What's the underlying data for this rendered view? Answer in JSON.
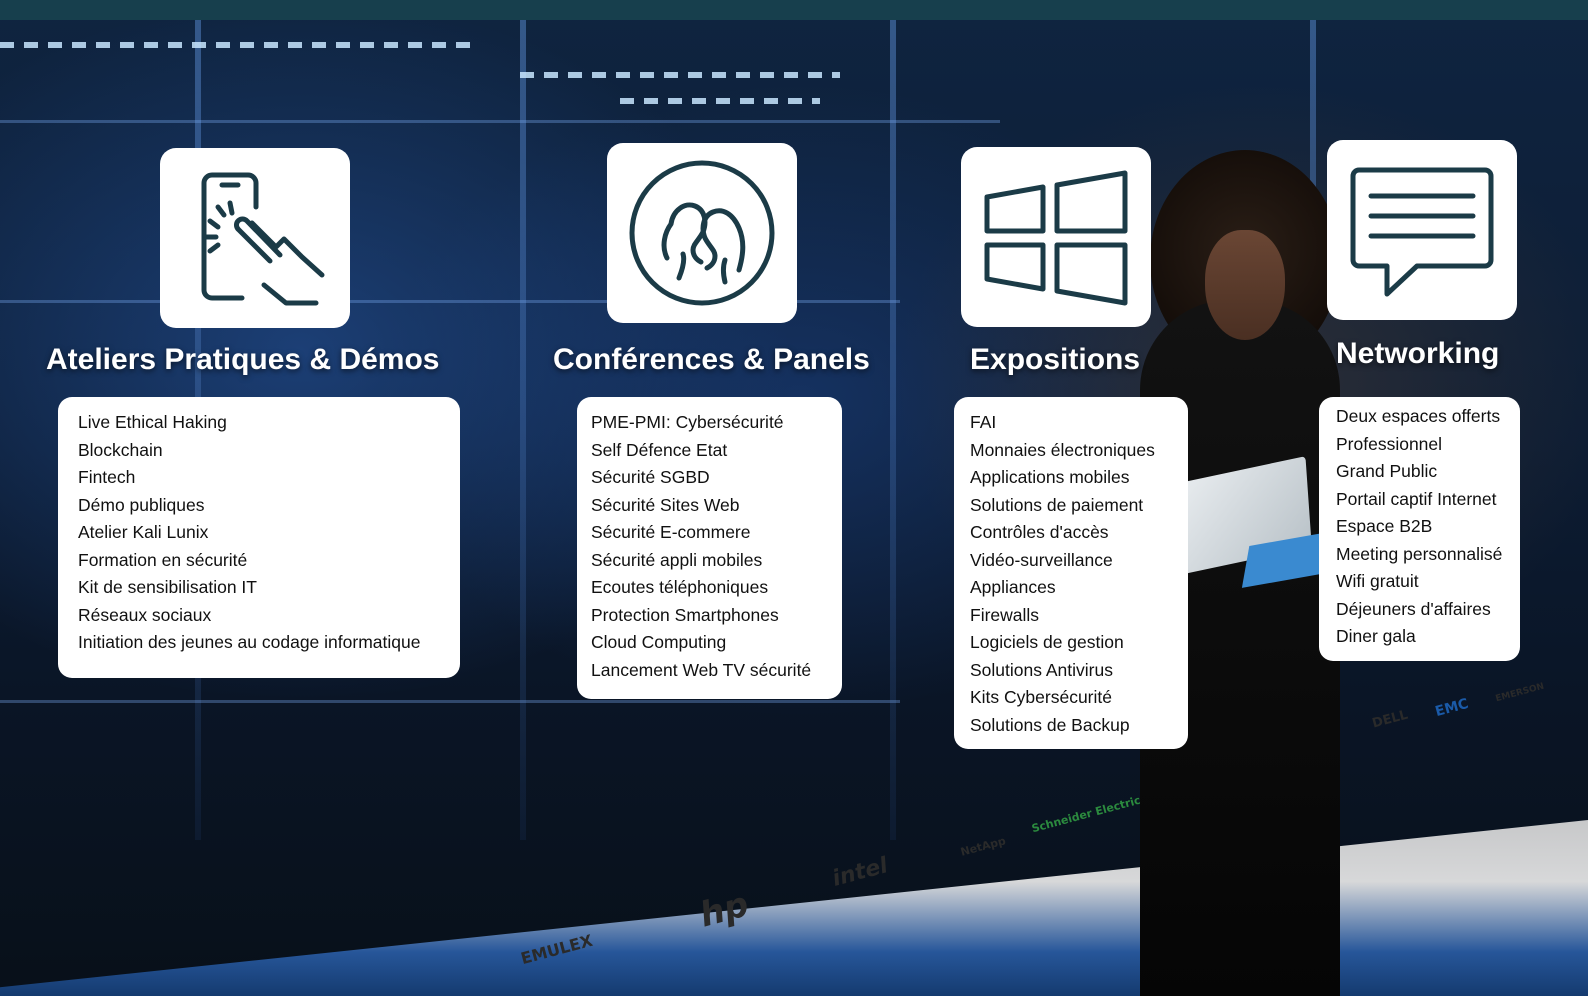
{
  "colors": {
    "top_bar": "#173f4d",
    "icon_stroke": "#1b3b47",
    "card_bg": "#ffffff",
    "title_text": "#ffffff"
  },
  "background_logos": [
    "EMULEX",
    "hp",
    "intel",
    "NetApp",
    "Schneider Electric",
    "DELL",
    "EMC",
    "EMERSON"
  ],
  "sections": [
    {
      "icon": "touch-screen-icon",
      "title": "Ateliers Pratiques & Démos",
      "items": [
        "Live Ethical Haking",
        "Blockchain",
        "Fintech",
        "Démo publiques",
        "Atelier Kali Lunix",
        "Formation en sécurité",
        "Kit de sensibilisation IT",
        "Réseaux sociaux",
        "Initiation des jeunes au codage informatique"
      ]
    },
    {
      "icon": "people-talking-icon",
      "title": "Conférences & Panels",
      "items": [
        "PME-PMI: Cybersécurité",
        "Self Défence Etat",
        "Sécurité SGBD",
        "Sécurité Sites Web",
        "Sécurité E-commere",
        "Sécurité appli mobiles",
        "Ecoutes téléphoniques",
        "Protection Smartphones",
        "Cloud Computing",
        "Lancement Web TV sécurité"
      ]
    },
    {
      "icon": "windows-logo-icon",
      "title": "Expositions",
      "items": [
        "FAI",
        "Monnaies électroniques",
        "Applications mobiles",
        "Solutions de paiement",
        "Contrôles d'accès",
        "Vidéo-surveillance",
        "Appliances",
        "Firewalls",
        "Logiciels de gestion",
        "Solutions Antivirus",
        "Kits Cybersécurité",
        "Solutions de Backup"
      ]
    },
    {
      "icon": "chat-bubble-icon",
      "title": "Networking",
      "items": [
        "Deux espaces offerts",
        "Professionnel",
        "Grand Public",
        "Portail captif Internet",
        "Espace B2B",
        "Meeting personnalisé",
        "Wifi gratuit",
        "Déjeuners d'affaires",
        "Diner gala"
      ]
    }
  ]
}
